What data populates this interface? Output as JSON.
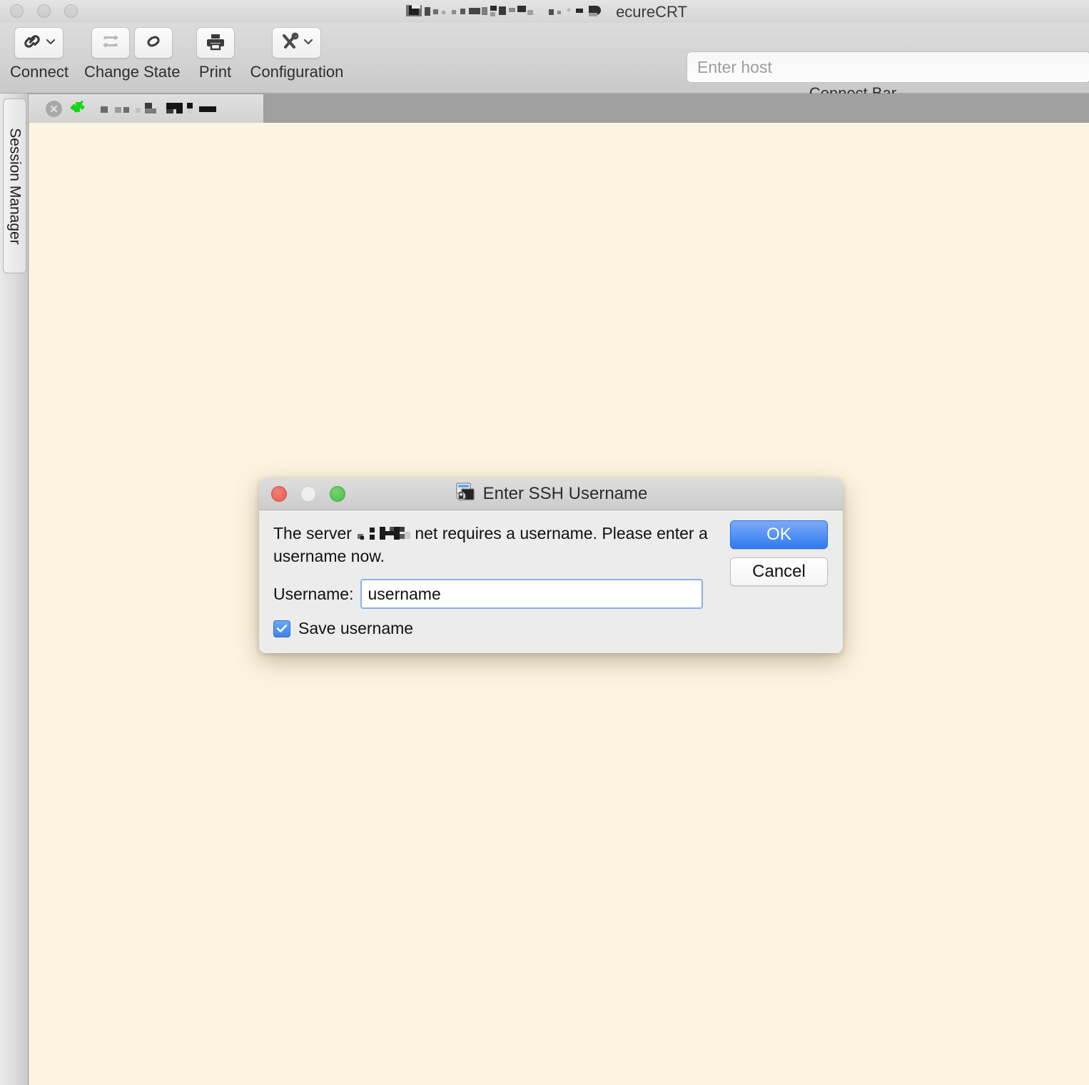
{
  "window": {
    "title_visible_suffix": "ecureCRT",
    "title_redacted": true,
    "traffic_lights": [
      "minimize-inactive",
      "zoom-inactive",
      "close-inactive"
    ]
  },
  "toolbar": {
    "groups": [
      {
        "label": "Connect",
        "buttons": [
          {
            "icon": "link-icon",
            "state": "enabled",
            "has_chevron": true
          }
        ]
      },
      {
        "label": "Change State",
        "buttons": [
          {
            "icon": "reconnect-loop-icon",
            "state": "disabled",
            "has_chevron": false
          },
          {
            "icon": "broken-link-icon",
            "state": "enabled",
            "has_chevron": false
          }
        ]
      },
      {
        "label": "Print",
        "buttons": [
          {
            "icon": "printer-icon",
            "state": "enabled",
            "has_chevron": false
          }
        ]
      },
      {
        "label": "Configuration",
        "buttons": [
          {
            "icon": "tools-icon",
            "state": "enabled",
            "has_chevron": true
          }
        ]
      }
    ],
    "connect_bar": {
      "label": "Connect Bar",
      "host_value": "",
      "host_placeholder": "Enter host"
    }
  },
  "sidebar": {
    "session_manager_label": "Session Manager"
  },
  "tabbar": {
    "active_tab": {
      "close_icon": "close-circle-icon",
      "status_icon": "green-checkmark-icon",
      "label_redacted": true
    }
  },
  "terminal": {
    "background_color": "#fdf4e0",
    "content": ""
  },
  "dialog": {
    "title": "Enter SSH Username",
    "title_icon": "terminal-lock-icon",
    "traffic_lights": {
      "close": "active-red",
      "minimize": "disabled",
      "zoom": "active-green"
    },
    "message_prefix": "The server ",
    "message_suffix": "net requires a username.  Please enter a username now.",
    "message_host_redacted": true,
    "username_label": "Username:",
    "username_value": "username",
    "save_username_label": "Save username",
    "save_username_checked": true,
    "ok_label": "OK",
    "cancel_label": "Cancel",
    "accent_color": "#2f7cf0"
  }
}
